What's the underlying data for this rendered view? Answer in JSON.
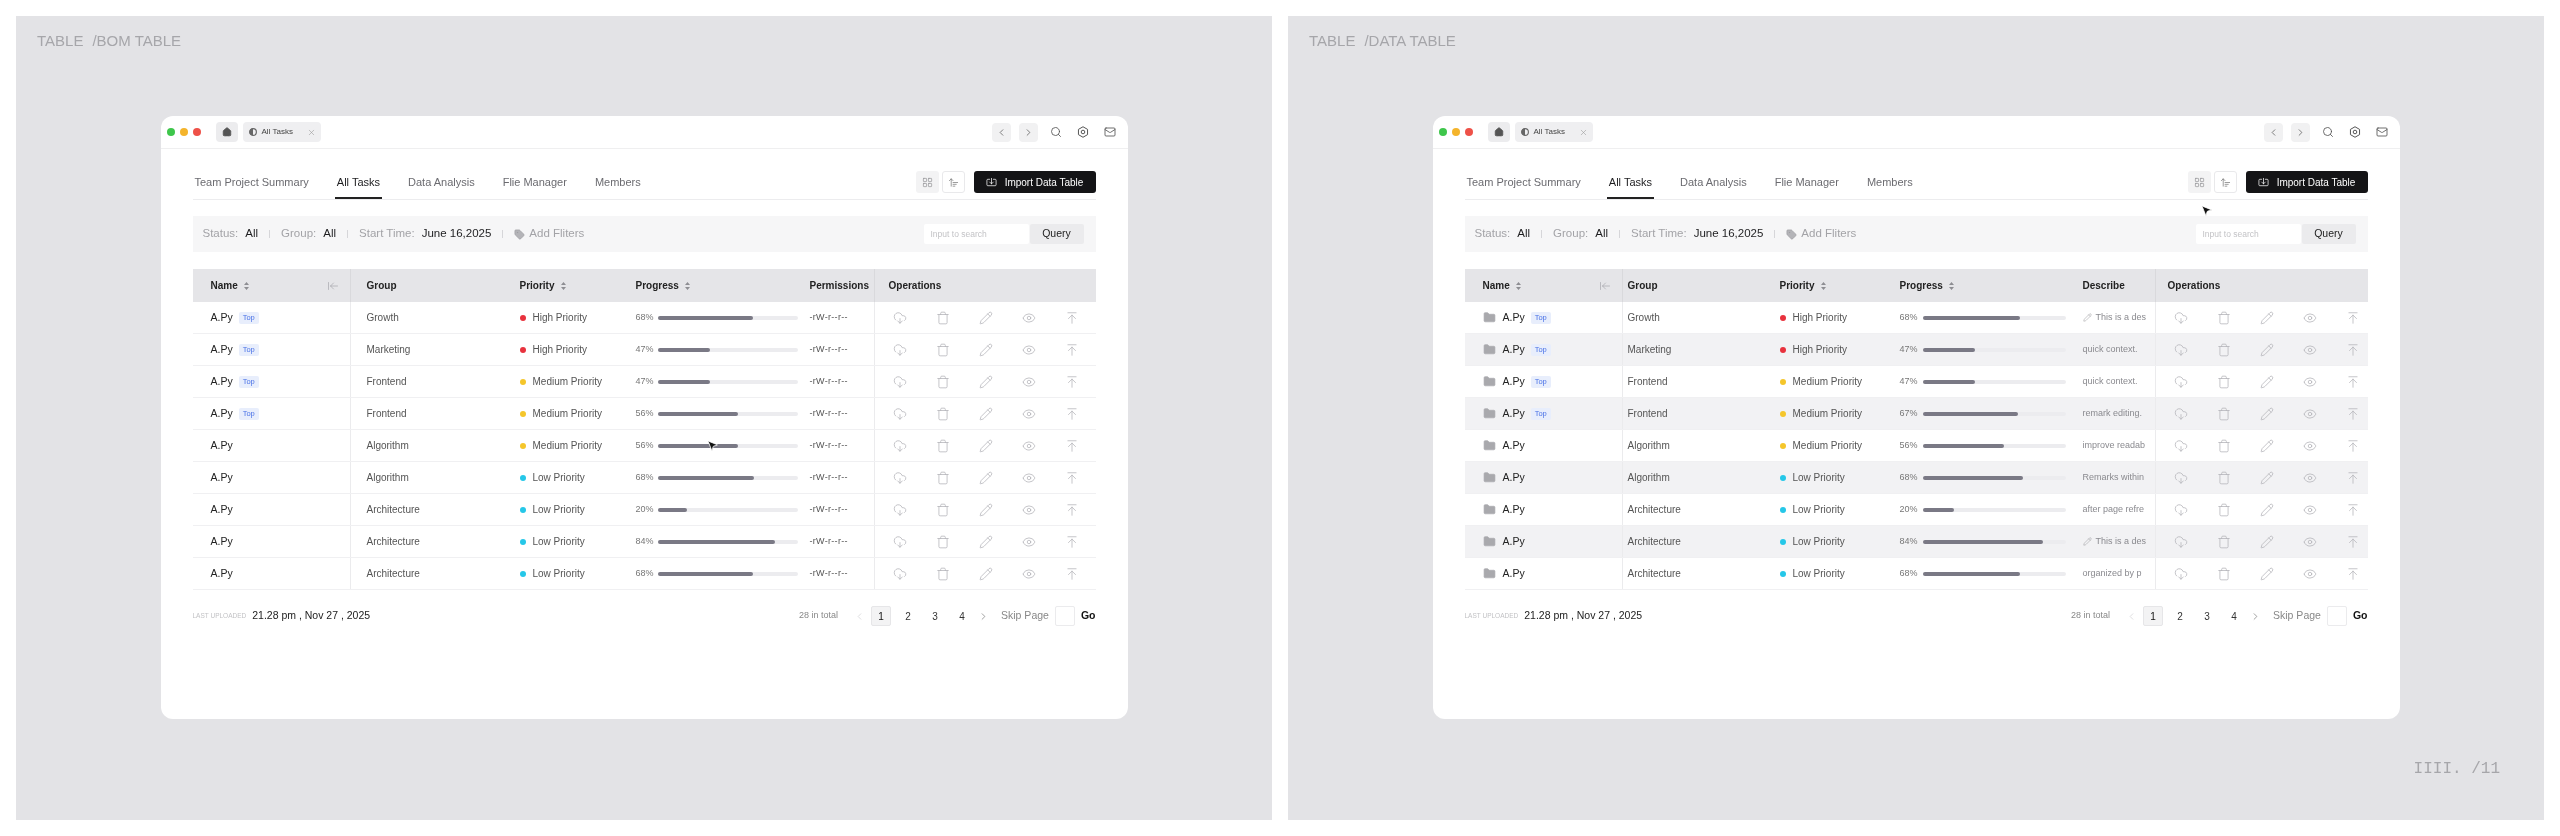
{
  "panels": [
    {
      "heading": {
        "label": "TABLE",
        "path": "/BOM TABLE"
      },
      "browser": {
        "tab_title": "All Tasks"
      },
      "nav_tabs": [
        {
          "label": "Team Project Summary",
          "selected": false
        },
        {
          "label": "All Tasks",
          "selected": true
        },
        {
          "label": "Data Analysis",
          "selected": false
        },
        {
          "label": "Flie Manager",
          "selected": false
        },
        {
          "label": "Members",
          "selected": false
        }
      ],
      "import_button": "Import Data Table",
      "filters": [
        {
          "label": "Status:",
          "value": "All"
        },
        {
          "label": "Group:",
          "value": "All"
        },
        {
          "label": "Start Time:",
          "value": "June 16,2025"
        }
      ],
      "add_filter": "Add Fliters",
      "search": {
        "placeholder": "Input to search"
      },
      "query_button": "Query",
      "table": {
        "kind": "permissions",
        "striped": false,
        "row_icons": false,
        "columns": [
          {
            "label": "Name",
            "sortable": true
          },
          {
            "label": "Group",
            "sortable": false
          },
          {
            "label": "Priority",
            "sortable": true
          },
          {
            "label": "Progress",
            "sortable": true
          },
          {
            "label": "Permissions",
            "sortable": false
          },
          {
            "label": "Operations",
            "sortable": false
          }
        ],
        "rows": [
          {
            "name": "A.Py",
            "tag": "Top",
            "group": "Growth",
            "priority": {
              "label": "High Priority",
              "color": "#e8323d"
            },
            "progress": "68%",
            "level": 0.68,
            "permissions": "-rW-r--r--"
          },
          {
            "name": "A.Py",
            "tag": "Top",
            "group": "Marketing",
            "priority": {
              "label": "High Priority",
              "color": "#e8323d"
            },
            "progress": "47%",
            "level": 0.37,
            "permissions": "-rW-r--r--"
          },
          {
            "name": "A.Py",
            "tag": "Top",
            "group": "Frontend",
            "priority": {
              "label": "Medium Priority",
              "color": "#f5c62b"
            },
            "progress": "47%",
            "level": 0.37,
            "permissions": "-rW-r--r--"
          },
          {
            "name": "A.Py",
            "tag": "Top",
            "group": "Frontend",
            "priority": {
              "label": "Medium Priority",
              "color": "#f5c62b"
            },
            "progress": "56%",
            "level": 0.57,
            "permissions": "-rW-r--r--"
          },
          {
            "name": "A.Py",
            "group": "Algorithm",
            "priority": {
              "label": "Medium Priority",
              "color": "#f5c62b"
            },
            "progress": "56%",
            "level": 0.57,
            "permissions": "-rW-r--r--"
          },
          {
            "name": "A.Py",
            "group": "Algorithm",
            "priority": {
              "label": "Low Priority",
              "color": "#25c7e8"
            },
            "progress": "68%",
            "level": 0.69,
            "permissions": "-rW-r--r--"
          },
          {
            "name": "A.Py",
            "group": "Architecture",
            "priority": {
              "label": "Low Priority",
              "color": "#25c7e8"
            },
            "progress": "20%",
            "level": 0.21,
            "permissions": "-rW-r--r--"
          },
          {
            "name": "A.Py",
            "group": "Architecture",
            "priority": {
              "label": "Low Priority",
              "color": "#25c7e8"
            },
            "progress": "84%",
            "level": 0.84,
            "permissions": "-rW-r--r--"
          },
          {
            "name": "A.Py",
            "group": "Architecture",
            "priority": {
              "label": "Low Priority",
              "color": "#25c7e8"
            },
            "progress": "68%",
            "level": 0.68,
            "permissions": "-rW-r--r--"
          }
        ]
      },
      "footer": {
        "uploaded_label": "LAST UPLOADED",
        "uploaded_time": "21.28 pm , Nov 27 , 2025",
        "total": "28 in total",
        "previous": {
          "disabled": true
        },
        "next": {
          "disabled": false
        },
        "pages": [
          {
            "label": "1",
            "selected": true
          },
          {
            "label": "2",
            "selected": false
          },
          {
            "label": "3",
            "selected": false
          },
          {
            "label": "4",
            "selected": false
          }
        ],
        "skip_label": "Skip Page",
        "go_button": "Go"
      }
    },
    {
      "heading": {
        "label": "TABLE",
        "path": "/DATA TABLE"
      },
      "browser": {
        "tab_title": "All Tasks"
      },
      "nav_tabs": [
        {
          "label": "Team Project Summary",
          "selected": false
        },
        {
          "label": "All Tasks",
          "selected": true
        },
        {
          "label": "Data Analysis",
          "selected": false
        },
        {
          "label": "Flie Manager",
          "selected": false
        },
        {
          "label": "Members",
          "selected": false
        }
      ],
      "import_button": "Import Data Table",
      "filters": [
        {
          "label": "Status:",
          "value": "All"
        },
        {
          "label": "Group:",
          "value": "All"
        },
        {
          "label": "Start Time:",
          "value": "June 16,2025"
        }
      ],
      "add_filter": "Add Fliters",
      "search": {
        "placeholder": "Input to search"
      },
      "query_button": "Query",
      "table": {
        "kind": "describe",
        "striped": true,
        "row_icons": true,
        "columns": [
          {
            "label": "Name",
            "sortable": true
          },
          {
            "label": "Group",
            "sortable": false
          },
          {
            "label": "Priority",
            "sortable": true
          },
          {
            "label": "Progress",
            "sortable": true
          },
          {
            "label": "Describe",
            "sortable": false
          },
          {
            "label": "Operations",
            "sortable": false
          }
        ],
        "rows": [
          {
            "name": "A.Py",
            "tag": "Top",
            "group": "Growth",
            "priority": {
              "label": "High Priority",
              "color": "#e8323d"
            },
            "progress": "68%",
            "level": 0.68,
            "describe": "This is a des",
            "note_icon": true
          },
          {
            "name": "A.Py",
            "tag": "Top",
            "group": "Marketing",
            "priority": {
              "label": "High Priority",
              "color": "#e8323d"
            },
            "progress": "47%",
            "level": 0.37,
            "describe": "quick context.",
            "note_icon": false
          },
          {
            "name": "A.Py",
            "tag": "Top",
            "group": "Frontend",
            "priority": {
              "label": "Medium Priority",
              "color": "#f5c62b"
            },
            "progress": "47%",
            "level": 0.37,
            "describe": "quick context.",
            "note_icon": false
          },
          {
            "name": "A.Py",
            "tag": "Top",
            "group": "Frontend",
            "priority": {
              "label": "Medium Priority",
              "color": "#f5c62b"
            },
            "progress": "67%",
            "level": 0.67,
            "describe": "remark editing.",
            "note_icon": false
          },
          {
            "name": "A.Py",
            "group": "Algorithm",
            "priority": {
              "label": "Medium Priority",
              "color": "#f5c62b"
            },
            "progress": "56%",
            "level": 0.57,
            "describe": "improve readab",
            "note_icon": false
          },
          {
            "name": "A.Py",
            "group": "Algorithm",
            "priority": {
              "label": "Low Priority",
              "color": "#25c7e8"
            },
            "progress": "68%",
            "level": 0.7,
            "describe": "Remarks within",
            "note_icon": false
          },
          {
            "name": "A.Py",
            "group": "Architecture",
            "priority": {
              "label": "Low Priority",
              "color": "#25c7e8"
            },
            "progress": "20%",
            "level": 0.22,
            "describe": "after page refre",
            "note_icon": false
          },
          {
            "name": "A.Py",
            "group": "Architecture",
            "priority": {
              "label": "Low Priority",
              "color": "#25c7e8"
            },
            "progress": "84%",
            "level": 0.84,
            "describe": "This is a des",
            "note_icon": true
          },
          {
            "name": "A.Py",
            "group": "Architecture",
            "priority": {
              "label": "Low Priority",
              "color": "#25c7e8"
            },
            "progress": "68%",
            "level": 0.68,
            "describe": "organized by p",
            "note_icon": false
          }
        ]
      },
      "footer": {
        "uploaded_label": "LAST UPLOADED",
        "uploaded_time": "21.28 pm , Nov 27 , 2025",
        "total": "28 in total",
        "previous": {
          "disabled": true
        },
        "next": {
          "disabled": false
        },
        "pages": [
          {
            "label": "1",
            "selected": true
          },
          {
            "label": "2",
            "selected": false
          },
          {
            "label": "3",
            "selected": false
          },
          {
            "label": "4",
            "selected": false
          }
        ],
        "skip_label": "Skip Page",
        "go_button": "Go"
      },
      "page_number": "IIII. /11"
    }
  ]
}
